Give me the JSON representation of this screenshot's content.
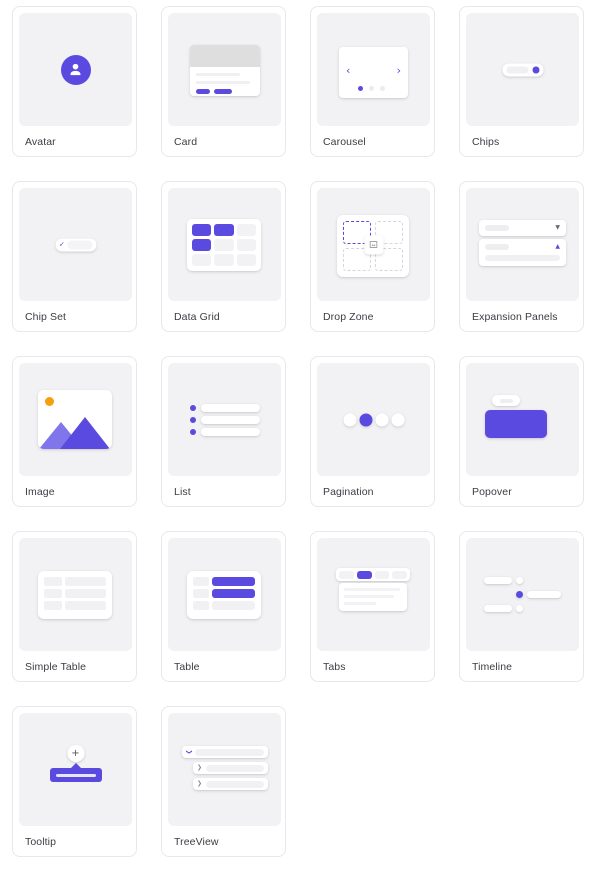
{
  "theme": {
    "accent": "#5b4ae0",
    "accent_light": "#8075ea",
    "sun": "#f59f0b",
    "thumb_bg": "#f2f2f4",
    "card_border": "#e8e8ec",
    "label_color": "#3c3c43",
    "page_bg": "#ffffff"
  },
  "gallery": {
    "columns": 4,
    "items": [
      {
        "id": "avatar",
        "label": "Avatar",
        "preview": "avatar-preview"
      },
      {
        "id": "card",
        "label": "Card",
        "preview": "card-preview"
      },
      {
        "id": "carousel",
        "label": "Carousel",
        "preview": "carousel-preview"
      },
      {
        "id": "chips",
        "label": "Chips",
        "preview": "chips-preview"
      },
      {
        "id": "chip-set",
        "label": "Chip Set",
        "preview": "chip-set-preview"
      },
      {
        "id": "data-grid",
        "label": "Data Grid",
        "preview": "data-grid-preview"
      },
      {
        "id": "drop-zone",
        "label": "Drop Zone",
        "preview": "drop-zone-preview"
      },
      {
        "id": "expansion-panels",
        "label": "Expansion Panels",
        "preview": "expansion-panels-preview"
      },
      {
        "id": "image",
        "label": "Image",
        "preview": "image-preview"
      },
      {
        "id": "list",
        "label": "List",
        "preview": "list-preview"
      },
      {
        "id": "pagination",
        "label": "Pagination",
        "preview": "pagination-preview"
      },
      {
        "id": "popover",
        "label": "Popover",
        "preview": "popover-preview"
      },
      {
        "id": "simple-table",
        "label": "Simple Table",
        "preview": "simple-table-preview"
      },
      {
        "id": "table",
        "label": "Table",
        "preview": "table-preview"
      },
      {
        "id": "tabs",
        "label": "Tabs",
        "preview": "tabs-preview"
      },
      {
        "id": "timeline",
        "label": "Timeline",
        "preview": "timeline-preview"
      },
      {
        "id": "tooltip",
        "label": "Tooltip",
        "preview": "tooltip-preview"
      },
      {
        "id": "treeview",
        "label": "TreeView",
        "preview": "treeview-preview"
      }
    ]
  },
  "previews": {
    "carousel": {
      "prev_glyph": "‹",
      "next_glyph": "›",
      "dot_count": 3,
      "active_dot": 0
    },
    "chip_set": {
      "check_glyph": "✓"
    },
    "expansion_panels": {
      "collapsed_glyph": "▼",
      "expanded_glyph": "▲",
      "panel_count": 2
    },
    "pagination": {
      "dot_count": 4,
      "active_dot": 1
    },
    "tabs": {
      "tab_count": 4,
      "active_tab": 1
    },
    "tooltip": {
      "add_glyph": "+"
    },
    "treeview": {
      "expanded_glyph": "❯",
      "collapsed_glyph": "❯",
      "row_count": 3
    },
    "data_grid": {
      "rows": 3,
      "cols": 3,
      "highlighted": [
        [
          0,
          0
        ],
        [
          0,
          1
        ],
        [
          1,
          0
        ]
      ]
    },
    "drop_zone": {
      "slots": 4,
      "active_slot": 0
    },
    "timeline": {
      "nodes": 3,
      "active_node": 1
    }
  }
}
